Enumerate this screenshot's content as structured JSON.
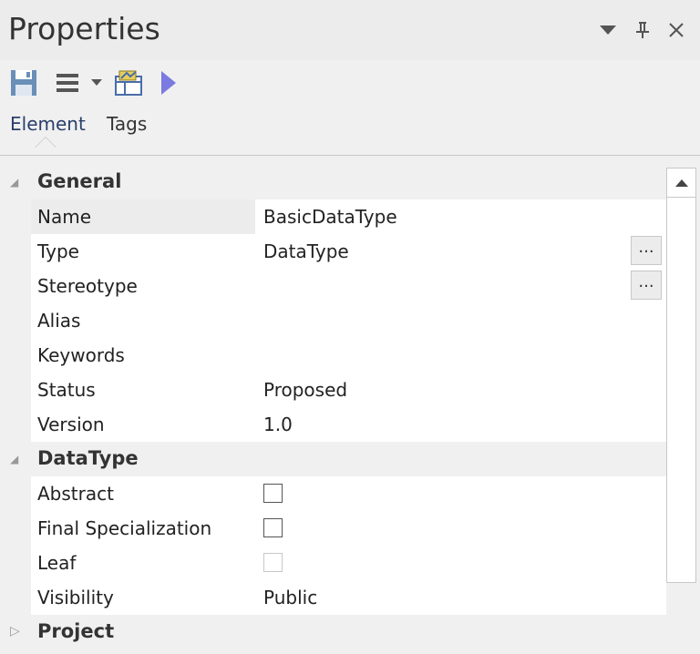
{
  "window": {
    "title": "Properties",
    "controls": [
      "dropdown-icon",
      "pin-icon",
      "close-icon"
    ]
  },
  "toolbar": {
    "buttons": [
      "save-icon",
      "menu-icon",
      "dropdown-arrow-icon",
      "element-browser-icon",
      "play-icon"
    ]
  },
  "tabs": [
    {
      "label": "Element",
      "active": true
    },
    {
      "label": "Tags",
      "active": false
    }
  ],
  "grid": {
    "categories": [
      {
        "label": "General",
        "expanded": true,
        "properties": [
          {
            "name": "Name",
            "value": "BasicDataType"
          },
          {
            "name": "Type",
            "value": "DataType",
            "ellipsis": "..."
          },
          {
            "name": "Stereotype",
            "value": "",
            "ellipsis": "..."
          },
          {
            "name": "Alias",
            "value": ""
          },
          {
            "name": "Keywords",
            "value": ""
          },
          {
            "name": "Status",
            "value": "Proposed"
          },
          {
            "name": "Version",
            "value": "1.0"
          }
        ]
      },
      {
        "label": "DataType",
        "expanded": true,
        "properties": [
          {
            "name": "Abstract",
            "checkbox": false
          },
          {
            "name": "Final Specialization",
            "checkbox": false
          },
          {
            "name": "Leaf",
            "checkbox": false,
            "disabled": true
          },
          {
            "name": "Visibility",
            "value": "Public"
          }
        ]
      },
      {
        "label": "Project",
        "expanded": false,
        "properties": []
      }
    ]
  },
  "colors": {
    "accent_tab": "#2a3f6b",
    "save_icon": "#6a8fb8",
    "play_icon": "#7a7ae0"
  }
}
